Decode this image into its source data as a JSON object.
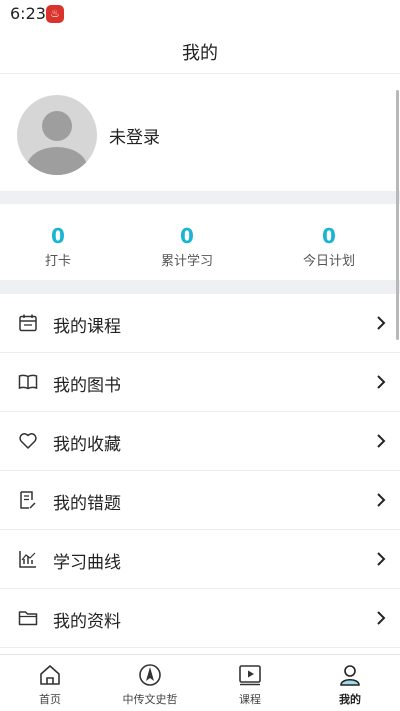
{
  "status_bar": {
    "time": "6:23",
    "app_icon": "red-app-badge-icon"
  },
  "header": {
    "title": "我的"
  },
  "profile": {
    "login_text": "未登录",
    "avatar_icon": "default-avatar-icon"
  },
  "stats": [
    {
      "value": "0",
      "label": "打卡"
    },
    {
      "value": "0",
      "label": "累计学习"
    },
    {
      "value": "0",
      "label": "今日计划"
    }
  ],
  "menu": [
    {
      "label": "我的课程",
      "icon": "calendar-icon"
    },
    {
      "label": "我的图书",
      "icon": "book-icon"
    },
    {
      "label": "我的收藏",
      "icon": "heart-icon"
    },
    {
      "label": "我的错题",
      "icon": "document-edit-icon"
    },
    {
      "label": "学习曲线",
      "icon": "chart-icon"
    },
    {
      "label": "我的资料",
      "icon": "folder-icon"
    }
  ],
  "tabs": [
    {
      "label": "首页",
      "icon": "home-icon",
      "active": false
    },
    {
      "label": "中传文史哲",
      "icon": "compass-icon",
      "active": false
    },
    {
      "label": "课程",
      "icon": "play-icon",
      "active": false
    },
    {
      "label": "我的",
      "icon": "user-icon",
      "active": true
    }
  ],
  "colors": {
    "accent": "#1bb5d3",
    "divider_band": "#eef0f3",
    "badge_red": "#d9332b"
  }
}
